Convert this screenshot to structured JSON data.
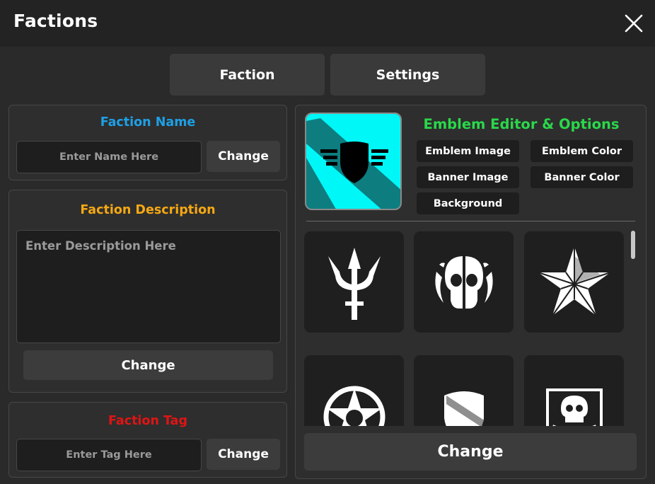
{
  "window": {
    "title": "Factions",
    "close_icon": "close-icon"
  },
  "tabs": [
    {
      "label": "Faction"
    },
    {
      "label": "Settings"
    }
  ],
  "faction_name": {
    "title": "Faction Name",
    "color": "#1ea0e6",
    "placeholder": "Enter Name Here",
    "button": "Change"
  },
  "faction_description": {
    "title": "Faction Description",
    "color": "#f5a814",
    "placeholder": "Enter Description Here",
    "button": "Change"
  },
  "faction_tag": {
    "title": "Faction Tag",
    "color": "#e01414",
    "placeholder": "Enter Tag Here",
    "button": "Change"
  },
  "emblem_editor": {
    "title": "Emblem Editor & Options",
    "color": "#2ad84a",
    "preview": {
      "banner_color": "#00f7f7",
      "stripe_color": "#0d7d80",
      "emblem_icon": "winged-shield-icon"
    },
    "options": [
      {
        "label": "Emblem Image"
      },
      {
        "label": "Emblem Color"
      },
      {
        "label": "Banner Image"
      },
      {
        "label": "Banner Color"
      },
      {
        "label": "Background"
      }
    ],
    "emblems": [
      {
        "icon": "trident-icon"
      },
      {
        "icon": "skull-icon"
      },
      {
        "icon": "star-icon"
      },
      {
        "icon": "circle-star-icon"
      },
      {
        "icon": "shield-icon"
      },
      {
        "icon": "skull-crossbones-icon"
      }
    ],
    "button": "Change"
  }
}
